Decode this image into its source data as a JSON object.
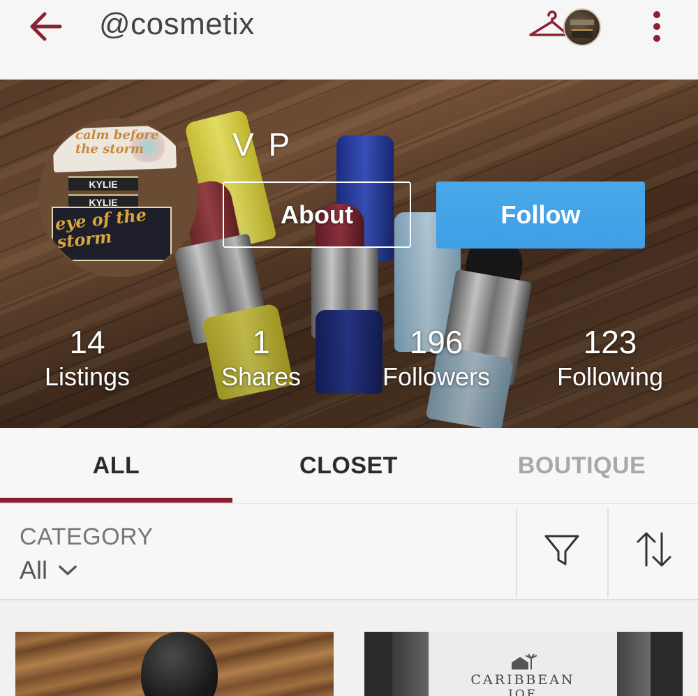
{
  "header": {
    "username": "@cosmetix"
  },
  "profile": {
    "display_name": "V P",
    "avatar_text": {
      "line1": "calm before the storm",
      "bar1": "KYLIE",
      "bar2": "KYLIE",
      "line2": "eye of the storm"
    },
    "about_label": "About",
    "follow_label": "Follow",
    "stats": [
      {
        "value": "14",
        "label": "Listings"
      },
      {
        "value": "1",
        "label": "Shares"
      },
      {
        "value": "196",
        "label": "Followers"
      },
      {
        "value": "123",
        "label": "Following"
      }
    ]
  },
  "tabs": [
    {
      "label": "ALL",
      "active": true
    },
    {
      "label": "CLOSET",
      "active": false
    },
    {
      "label": "BOUTIQUE",
      "active": false
    }
  ],
  "filters": {
    "category_label": "CATEGORY",
    "category_value": "All"
  },
  "listings": [
    {
      "image": "black beauty blender sponge on wood"
    },
    {
      "image": "Caribbean Joe box",
      "brand_line1": "CARIBBEAN",
      "brand_line2": "JOE"
    }
  ],
  "colors": {
    "brand": "#8a1f32",
    "follow": "#3f9fe6"
  }
}
